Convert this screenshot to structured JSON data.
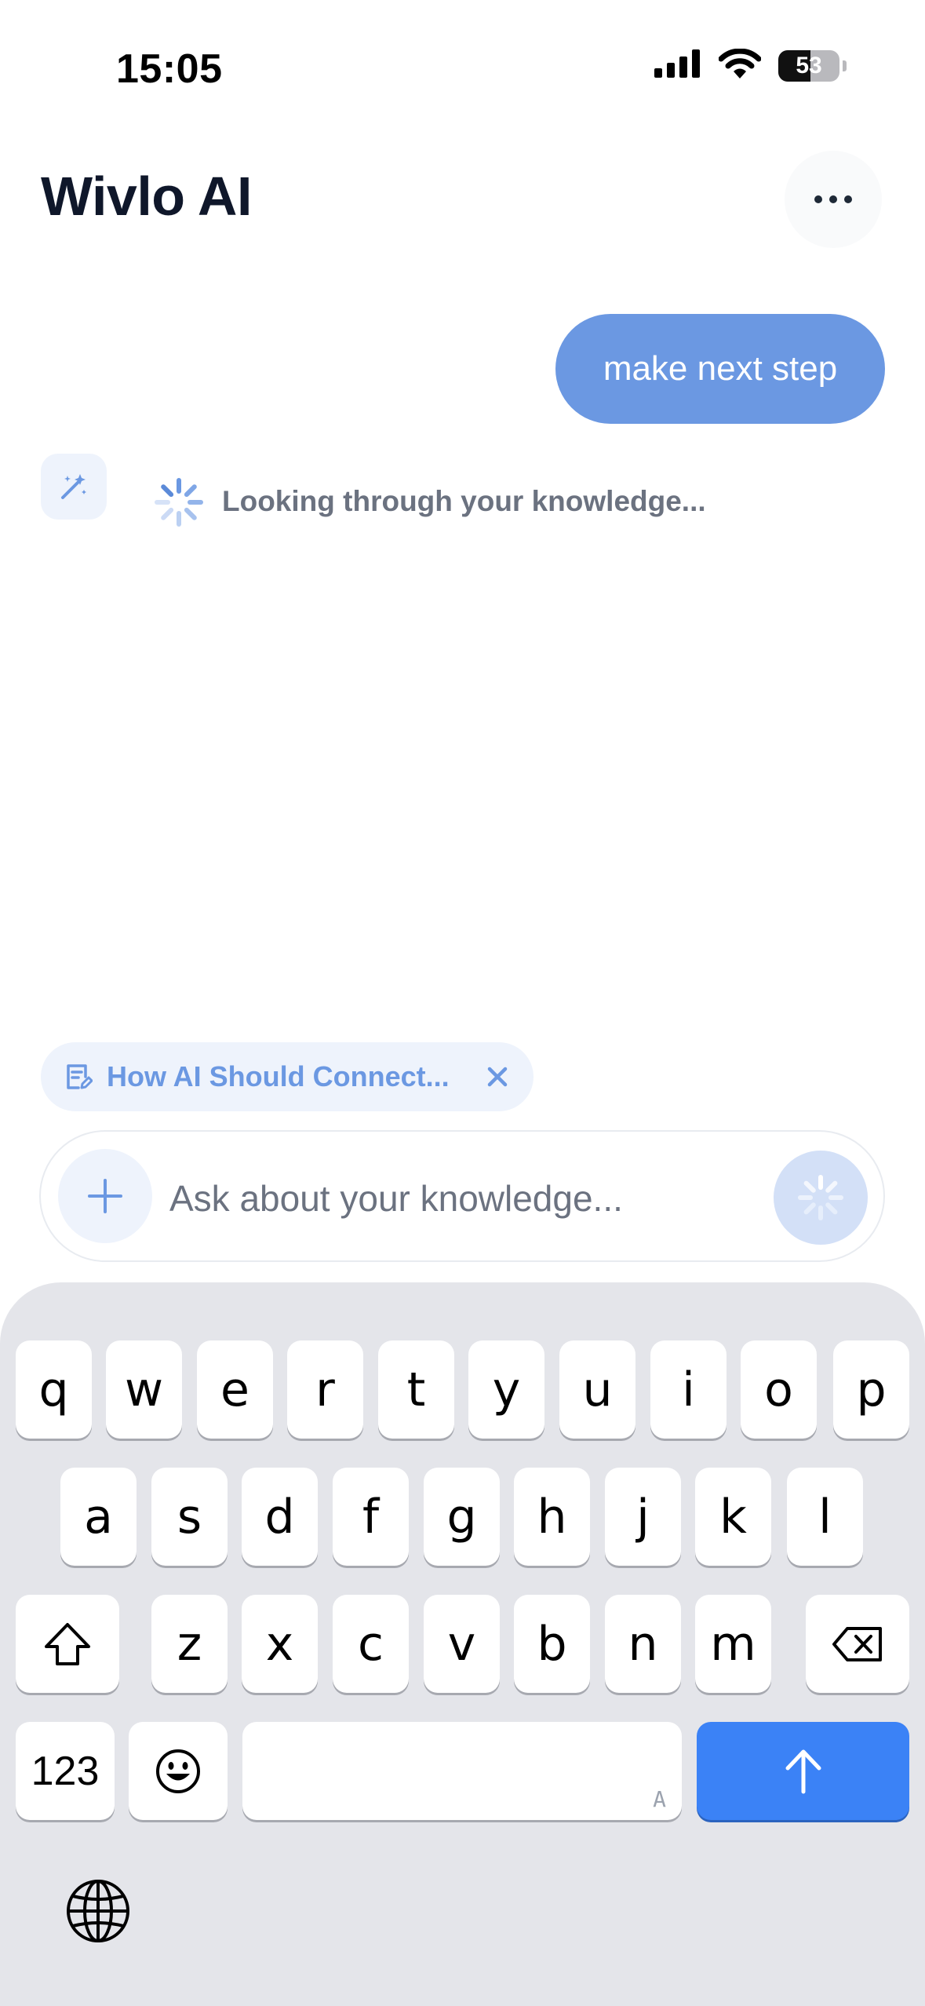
{
  "status_bar": {
    "time": "15:05",
    "battery": "53",
    "battery_level": 0.53
  },
  "header": {
    "title": "Wivlo AI"
  },
  "chat": {
    "user_message": "make next step",
    "assistant_status": "Looking through your knowledge..."
  },
  "context_chip": {
    "label": "How AI Should Connect..."
  },
  "composer": {
    "placeholder": "Ask about your knowledge..."
  },
  "keyboard": {
    "row1": [
      "q",
      "w",
      "e",
      "r",
      "t",
      "y",
      "u",
      "i",
      "o",
      "p"
    ],
    "row2": [
      "a",
      "s",
      "d",
      "f",
      "g",
      "h",
      "j",
      "k",
      "l"
    ],
    "row3": [
      "z",
      "x",
      "c",
      "v",
      "b",
      "n",
      "m"
    ],
    "numbers_label": "123",
    "space_hint": "A"
  },
  "colors": {
    "accent": "#6b98e2",
    "send_key": "#3b82f6",
    "keyboard_bg": "#e4e5ea"
  },
  "icons": [
    "cellular-signal-icon",
    "wifi-icon",
    "battery-icon",
    "more-icon",
    "magic-wand-icon",
    "loading-spinner-icon",
    "note-icon",
    "close-icon",
    "plus-icon",
    "shift-icon",
    "backspace-icon",
    "emoji-icon",
    "arrow-up-icon",
    "globe-icon"
  ]
}
